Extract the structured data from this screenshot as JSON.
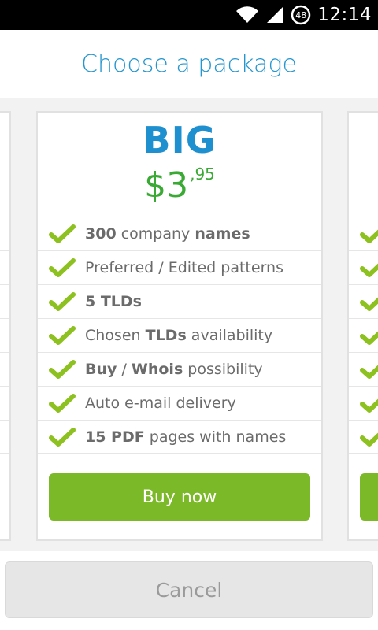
{
  "status_bar": {
    "time": "12:14",
    "battery_level": "48",
    "icons": [
      "wifi-icon",
      "signal-icon",
      "battery-icon"
    ]
  },
  "header": {
    "title": "Choose a package"
  },
  "package": {
    "name": "BIG",
    "price_currency": "$",
    "price_whole": "3",
    "price_cents": ",95",
    "features": [
      {
        "parts": [
          {
            "text": "300",
            "bold": true
          },
          {
            "text": " company ",
            "bold": false
          },
          {
            "text": "names",
            "bold": true
          }
        ]
      },
      {
        "parts": [
          {
            "text": "Preferred / Edited patterns",
            "bold": false
          }
        ]
      },
      {
        "parts": [
          {
            "text": "5 TLDs",
            "bold": true
          }
        ]
      },
      {
        "parts": [
          {
            "text": "Chosen ",
            "bold": false
          },
          {
            "text": "TLDs",
            "bold": true
          },
          {
            "text": " availability",
            "bold": false
          }
        ]
      },
      {
        "parts": [
          {
            "text": "Buy",
            "bold": true
          },
          {
            "text": " / ",
            "bold": false
          },
          {
            "text": "Whois",
            "bold": true
          },
          {
            "text": " possibility",
            "bold": false
          }
        ]
      },
      {
        "parts": [
          {
            "text": "Auto e-mail delivery",
            "bold": false
          }
        ]
      },
      {
        "parts": [
          {
            "text": "15 PDF",
            "bold": true
          },
          {
            "text": " pages with names",
            "bold": false
          }
        ]
      }
    ],
    "buy_label": "Buy now"
  },
  "footer": {
    "cancel_label": "Cancel"
  },
  "colors": {
    "title_blue": "#2496d0",
    "package_blue": "#1e8fcf",
    "price_green": "#3aaa35",
    "button_green": "#7cb929",
    "check_green": "#8cc11f",
    "text_gray": "#6b6b6b"
  }
}
